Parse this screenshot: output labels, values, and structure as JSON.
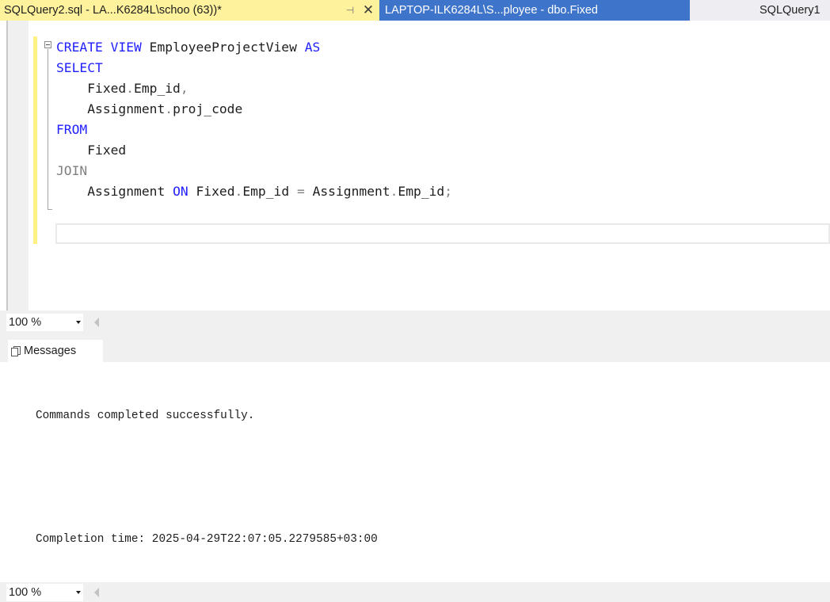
{
  "tabs": [
    {
      "title": "SQLQuery2.sql - LA...K6284L\\schoo (63))*",
      "pin_glyph": "⊣",
      "close_glyph": "✕",
      "active": true
    },
    {
      "title": "LAPTOP-ILK6284L\\S...ployee - dbo.Fixed",
      "active": false
    },
    {
      "title": "SQLQuery1",
      "active": false
    }
  ],
  "editor": {
    "lines": [
      {
        "kw1": "CREATE",
        "kw2": "VIEW",
        "name": "EmployeeProjectView",
        "kw3": "AS"
      },
      {
        "kw": "SELECT"
      },
      {
        "table": "Fixed",
        "dot": ".",
        "col": "Emp_id",
        "comma": ","
      },
      {
        "table": "Assignment",
        "dot": ".",
        "col": "proj_code"
      },
      {
        "kw": "FROM"
      },
      {
        "table": "Fixed"
      },
      {
        "kw": "JOIN"
      },
      {
        "table1": "Assignment",
        "kw_on": "ON",
        "t2": "Fixed",
        "c2": "Emp_id",
        "eq": "=",
        "t3": "Assignment",
        "c3": "Emp_id",
        "semi": ";"
      }
    ]
  },
  "zoom": {
    "top": "100 %",
    "bottom": "100 %"
  },
  "results": {
    "tab_label": "Messages",
    "messages": [
      "Commands completed successfully.",
      "",
      "Completion time: 2025-04-29T22:07:05.2279585+03:00"
    ]
  },
  "icons": {
    "fold": "minus-box-icon",
    "messages": "messages-icon",
    "zoom_dropdown": "chevron-down-icon",
    "scroll": "scroll-left-icon"
  },
  "colors": {
    "active_tab": "#fff29d",
    "inactive_tab_blue": "#3e74c9",
    "keyword": "#1f1fff",
    "keyword_grey": "#808080",
    "change_marker": "#fff183"
  }
}
